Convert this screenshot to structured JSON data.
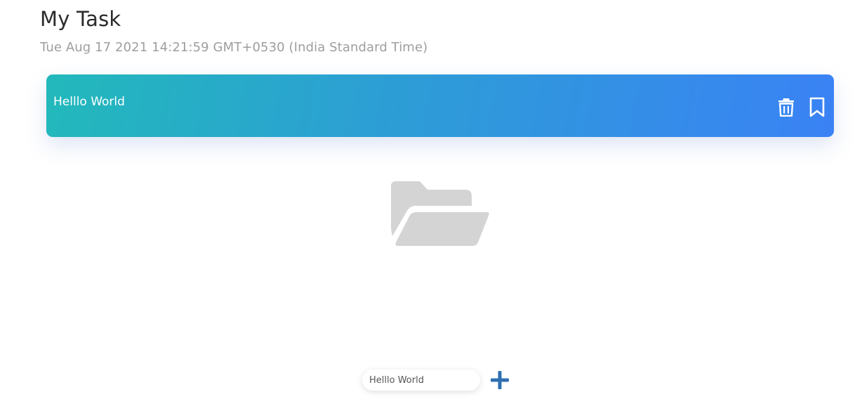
{
  "header": {
    "title": "My Task",
    "date": "Tue Aug 17 2021 14:21:59 GMT+0530 (India Standard Time)"
  },
  "tasks": [
    {
      "text": "Helllo World",
      "actions": [
        "trash-icon",
        "bookmark-icon"
      ]
    }
  ],
  "empty_state": {
    "icon": "folder-open-icon",
    "color": "#d4d4d4"
  },
  "add_bar": {
    "input_value": "Helllo World",
    "button_icon": "plus-icon",
    "button_color": "#2f6fb2"
  },
  "colors": {
    "card_gradient_start": "#22b9bb",
    "card_gradient_end": "#3a82f5",
    "title": "#2b2b2b",
    "date": "#9e9e9e"
  }
}
